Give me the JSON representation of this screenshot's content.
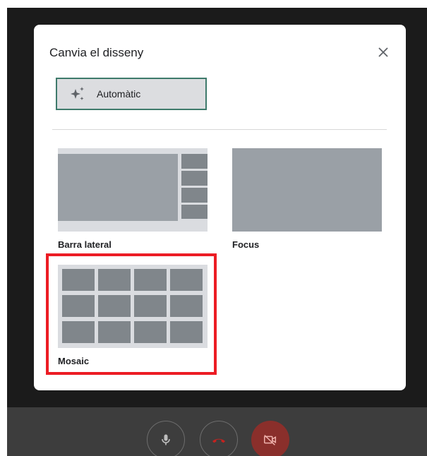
{
  "dialog": {
    "title": "Canvia el disseny",
    "close_icon": "close-icon",
    "auto_button": {
      "label": "Automàtic",
      "icon": "sparkle-icon"
    }
  },
  "layouts": [
    {
      "id": "sidebar",
      "label": "Barra lateral"
    },
    {
      "id": "focus",
      "label": "Focus"
    },
    {
      "id": "mosaic",
      "label": "Mosaic",
      "highlighted": true
    }
  ],
  "controls": {
    "mic_icon": "microphone-icon",
    "hangup_icon": "hang-up-icon",
    "camera_icon": "camera-off-icon"
  },
  "colors": {
    "thumb_bg": "#dadce0",
    "thumb_tile": "#9aa0a6",
    "mosaic_tile": "#80868b",
    "selected_border": "#3e7a6b",
    "highlight": "#ec1c24",
    "camera_off": "#8a2f2b"
  }
}
